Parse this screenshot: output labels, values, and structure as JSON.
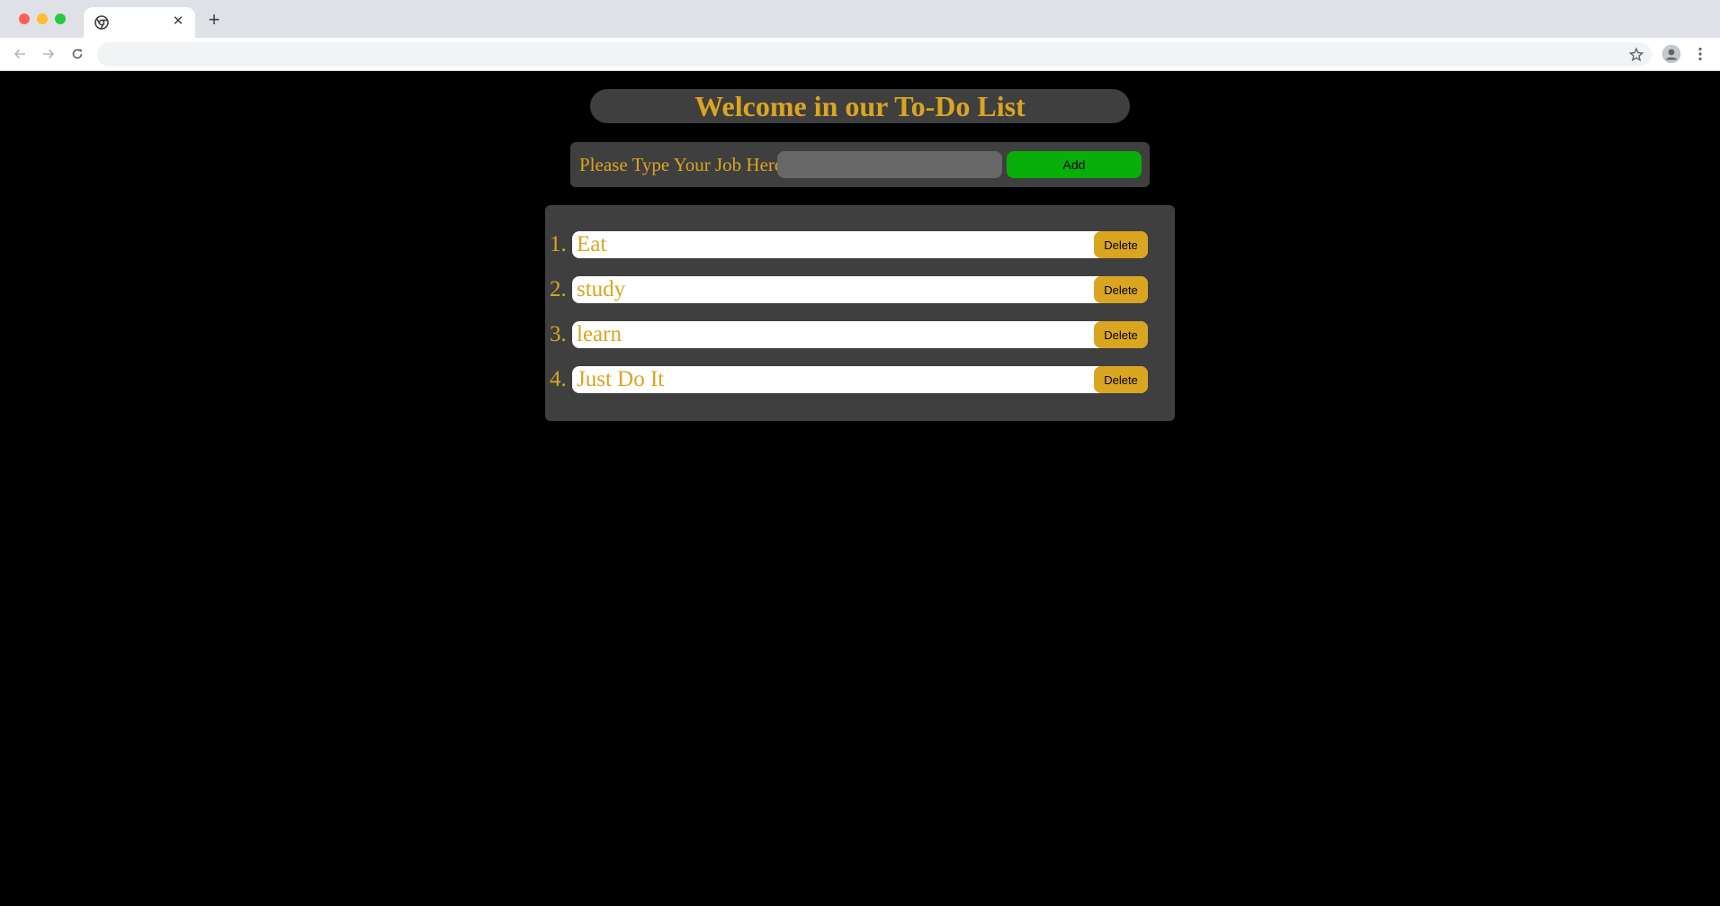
{
  "browser": {
    "tab_close_glyph": "✕",
    "new_tab_glyph": "+",
    "address": ""
  },
  "app": {
    "title": "Welcome in our To-Do List",
    "form": {
      "label": "Please Type Your Job Here",
      "input_value": "",
      "add_label": "Add"
    },
    "todos": [
      {
        "number": "1.",
        "text": "Eat",
        "delete_label": "Delete"
      },
      {
        "number": "2.",
        "text": "study",
        "delete_label": "Delete"
      },
      {
        "number": "3.",
        "text": "learn",
        "delete_label": "Delete"
      },
      {
        "number": "4.",
        "text": "Just Do It",
        "delete_label": "Delete"
      }
    ]
  },
  "colors": {
    "page_background": "#000000",
    "panel_background": "#3f3f3f",
    "accent_gold": "#daa520",
    "add_button_green": "#08af08",
    "input_gray": "#676767"
  },
  "icons": {
    "favicon": "chrome-icon",
    "back": "arrow-left-icon",
    "forward": "arrow-right-icon",
    "reload": "reload-icon",
    "bookmark": "star-icon",
    "profile": "avatar-icon",
    "menu": "kebab-menu-icon"
  }
}
